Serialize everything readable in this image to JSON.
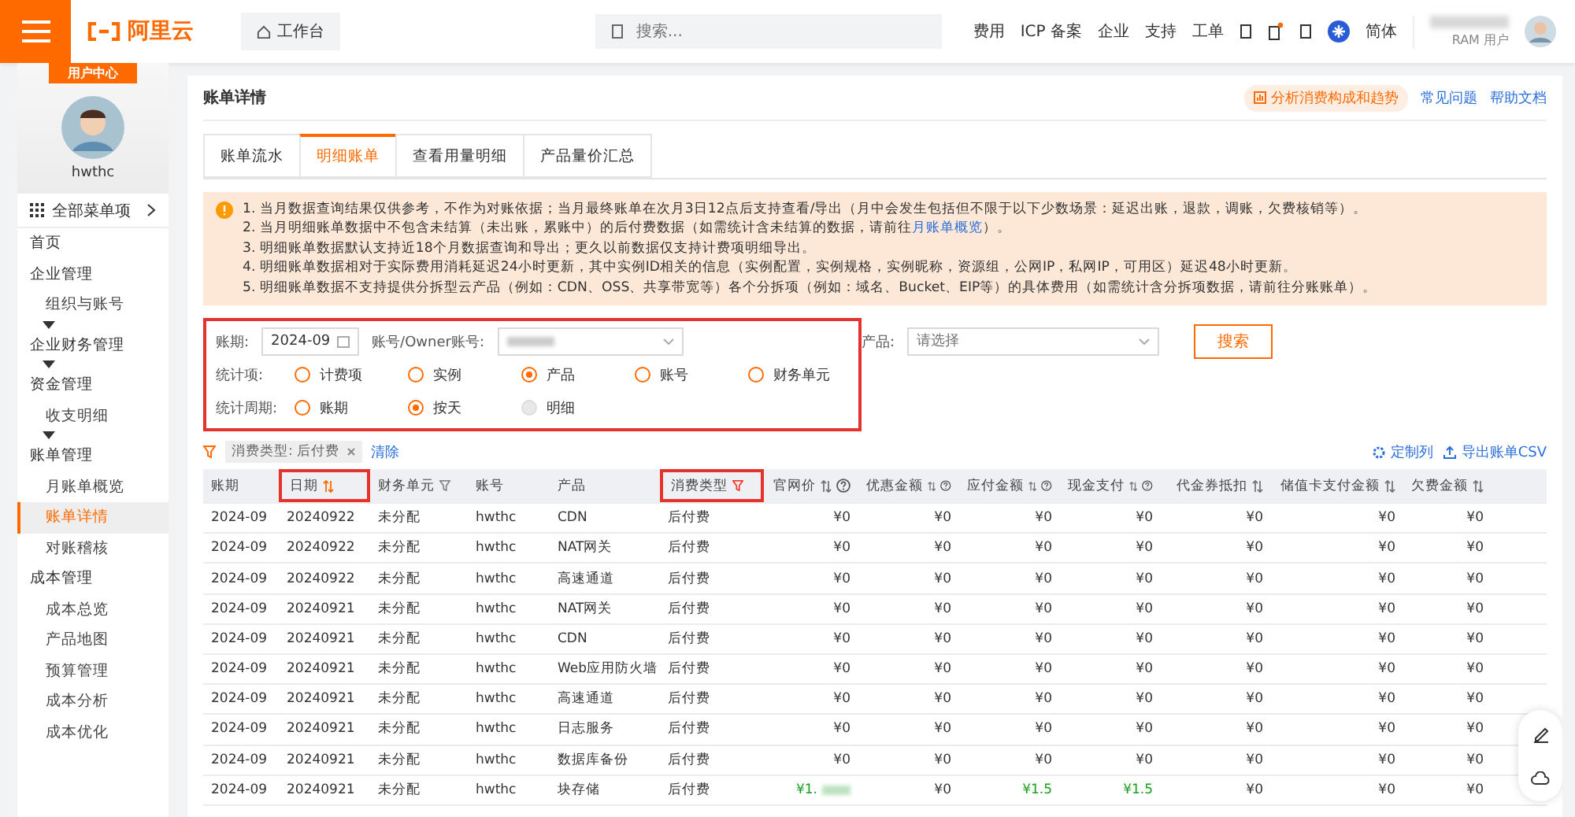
{
  "topbar": {
    "logo": "阿里云",
    "workbench": "工作台",
    "search": {
      "placeholder": "搜索..."
    },
    "links": [
      "费用",
      "ICP 备案",
      "企业",
      "支持",
      "工单"
    ],
    "language": "简体",
    "user_role": "RAM 用户"
  },
  "sidebar": {
    "badge": "用户中心",
    "username": "hwthc",
    "all_menu": "全部菜单项",
    "items": [
      {
        "kind": "item",
        "label": "首页",
        "selected": false
      },
      {
        "kind": "group",
        "label": "企业管理",
        "children": [
          {
            "label": "组织与账号",
            "selected": false
          }
        ],
        "collapsed": true
      },
      {
        "kind": "group",
        "label": "企业财务管理",
        "collapsed": true
      },
      {
        "kind": "group",
        "label": "资金管理",
        "children": [
          {
            "label": "收支明细",
            "selected": false
          }
        ],
        "collapsed": true
      },
      {
        "kind": "group",
        "label": "账单管理",
        "children": [
          {
            "label": "月账单概览",
            "selected": false
          },
          {
            "label": "账单详情",
            "selected": true
          },
          {
            "label": "对账稽核",
            "selected": false
          }
        ],
        "collapsed": false
      },
      {
        "kind": "group",
        "label": "成本管理",
        "children": [
          {
            "label": "成本总览",
            "selected": false
          },
          {
            "label": "产品地图",
            "selected": false
          },
          {
            "label": "预算管理",
            "selected": false
          },
          {
            "label": "成本分析",
            "selected": false
          },
          {
            "label": "成本优化",
            "selected": false
          }
        ],
        "collapsed": false
      }
    ]
  },
  "page": {
    "title": "账单详情",
    "analyze_button": "分析消费构成和趋势",
    "links": [
      "常见问题",
      "帮助文档"
    ]
  },
  "tabs": [
    {
      "label": "账单流水",
      "selected": false
    },
    {
      "label": "明细账单",
      "selected": true
    },
    {
      "label": "查看用量明细",
      "selected": false
    },
    {
      "label": "产品量价汇总",
      "selected": false
    }
  ],
  "notice": {
    "lines": [
      {
        "text": "1. 当月数据查询结果仅供参考，不作为对账依据；当月最终账单在次月3日12点后支持查看/导出（月中会发生包括但不限于以下少数场景：延迟出账，退款，调账，欠费核销等）。"
      },
      {
        "text": "2. 当月明细账单数据中不包含未结算（未出账，累账中）的后付费数据（如需统计含未结算的数据，请前往",
        "link": "月账单概览",
        "tail": "）。"
      },
      {
        "text": "3. 明细账单数据默认支持近18个月数据查询和导出；更久以前数据仅支持计费项明细导出。"
      },
      {
        "text": "4. 明细账单数据相对于实际费用消耗延迟24小时更新，其中实例ID相关的信息（实例配置，实例规格，实例昵称，资源组，公网IP，私网IP，可用区）延迟48小时更新。"
      },
      {
        "text": "5. 明细账单数据不支持提供分拆型云产品（例如：CDN、OSS、共享带宽等）各个分拆项（例如：域名、Bucket、EIP等）的具体费用（如需统计含分拆项数据，请前往分账账单）。"
      }
    ]
  },
  "filters": {
    "highlighted": true,
    "period": {
      "label": "账期:",
      "value": "2024-09"
    },
    "account": {
      "label": "账号/Owner账号:"
    },
    "product": {
      "label": "产品:",
      "placeholder": "请选择"
    },
    "search_button": "搜索",
    "stat_item": {
      "label": "统计项:",
      "options": [
        {
          "label": "计费项",
          "selected": false,
          "disabled": false
        },
        {
          "label": "实例",
          "selected": false,
          "disabled": false
        },
        {
          "label": "产品",
          "selected": true,
          "disabled": false
        },
        {
          "label": "账号",
          "selected": false,
          "disabled": false
        },
        {
          "label": "财务单元",
          "selected": false,
          "disabled": false
        }
      ]
    },
    "stat_period": {
      "label": "统计周期:",
      "options": [
        {
          "label": "账期",
          "selected": false,
          "disabled": false
        },
        {
          "label": "按天",
          "selected": true,
          "disabled": false
        },
        {
          "label": "明细",
          "selected": false,
          "disabled": true
        }
      ]
    }
  },
  "active_filter": {
    "tag": "消费类型: 后付费",
    "clear": "清除"
  },
  "table_actions": [
    "定制列",
    "导出账单CSV"
  ],
  "table": {
    "columns": [
      {
        "label": "账期",
        "sort": false,
        "filter": false,
        "help": false,
        "highlighted": false
      },
      {
        "label": "日期",
        "sort": true,
        "filter": false,
        "help": false,
        "highlighted": true
      },
      {
        "label": "财务单元",
        "sort": false,
        "filter": true,
        "help": false,
        "highlighted": false
      },
      {
        "label": "账号",
        "sort": false,
        "filter": false,
        "help": false,
        "highlighted": false
      },
      {
        "label": "产品",
        "sort": false,
        "filter": false,
        "help": false,
        "highlighted": false
      },
      {
        "label": "消费类型",
        "sort": false,
        "filter": true,
        "help": false,
        "highlighted": true
      },
      {
        "label": "官网价",
        "sort": true,
        "filter": false,
        "help": true,
        "highlighted": false
      },
      {
        "label": "优惠金额",
        "sort": true,
        "filter": false,
        "help": true,
        "highlighted": false
      },
      {
        "label": "应付金额",
        "sort": true,
        "filter": false,
        "help": true,
        "highlighted": false
      },
      {
        "label": "现金支付",
        "sort": true,
        "filter": false,
        "help": true,
        "highlighted": false
      },
      {
        "label": "代金券抵扣",
        "sort": true,
        "filter": false,
        "help": false,
        "highlighted": false
      },
      {
        "label": "储值卡支付金额",
        "sort": true,
        "filter": false,
        "help": false,
        "highlighted": false
      },
      {
        "label": "欠费金额",
        "sort": true,
        "filter": false,
        "help": false,
        "highlighted": false
      }
    ],
    "rows": [
      [
        "2024-09",
        "20240922",
        "未分配",
        "hwthc",
        "CDN",
        "后付费",
        "¥0",
        "¥0",
        "¥0",
        "¥0",
        "¥0",
        "¥0",
        "¥0"
      ],
      [
        "2024-09",
        "20240922",
        "未分配",
        "hwthc",
        "NAT网关",
        "后付费",
        "¥0",
        "¥0",
        "¥0",
        "¥0",
        "¥0",
        "¥0",
        "¥0"
      ],
      [
        "2024-09",
        "20240922",
        "未分配",
        "hwthc",
        "高速通道",
        "后付费",
        "¥0",
        "¥0",
        "¥0",
        "¥0",
        "¥0",
        "¥0",
        "¥0"
      ],
      [
        "2024-09",
        "20240921",
        "未分配",
        "hwthc",
        "NAT网关",
        "后付费",
        "¥0",
        "¥0",
        "¥0",
        "¥0",
        "¥0",
        "¥0",
        "¥0"
      ],
      [
        "2024-09",
        "20240921",
        "未分配",
        "hwthc",
        "CDN",
        "后付费",
        "¥0",
        "¥0",
        "¥0",
        "¥0",
        "¥0",
        "¥0",
        "¥0"
      ],
      [
        "2024-09",
        "20240921",
        "未分配",
        "hwthc",
        "Web应用防火墙",
        "后付费",
        "¥0",
        "¥0",
        "¥0",
        "¥0",
        "¥0",
        "¥0",
        "¥0"
      ],
      [
        "2024-09",
        "20240921",
        "未分配",
        "hwthc",
        "高速通道",
        "后付费",
        "¥0",
        "¥0",
        "¥0",
        "¥0",
        "¥0",
        "¥0",
        "¥0"
      ],
      [
        "2024-09",
        "20240921",
        "未分配",
        "hwthc",
        "日志服务",
        "后付费",
        "¥0",
        "¥0",
        "¥0",
        "¥0",
        "¥0",
        "¥0",
        "¥0"
      ],
      [
        "2024-09",
        "20240921",
        "未分配",
        "hwthc",
        "数据库备份",
        "后付费",
        "¥0",
        "¥0",
        "¥0",
        "¥0",
        "¥0",
        "¥0",
        "¥0"
      ],
      [
        "2024-09",
        "20240921",
        "未分配",
        "hwthc",
        "块存储",
        "后付费",
        {
          "text": "¥1.",
          "color": "#1aa01a",
          "redacted": true
        },
        "¥0",
        {
          "text": "¥1.5",
          "color": "#1aa01a"
        },
        {
          "text": "¥1.5",
          "color": "#1aa01a"
        },
        "¥0",
        "¥0",
        "¥0"
      ]
    ]
  }
}
